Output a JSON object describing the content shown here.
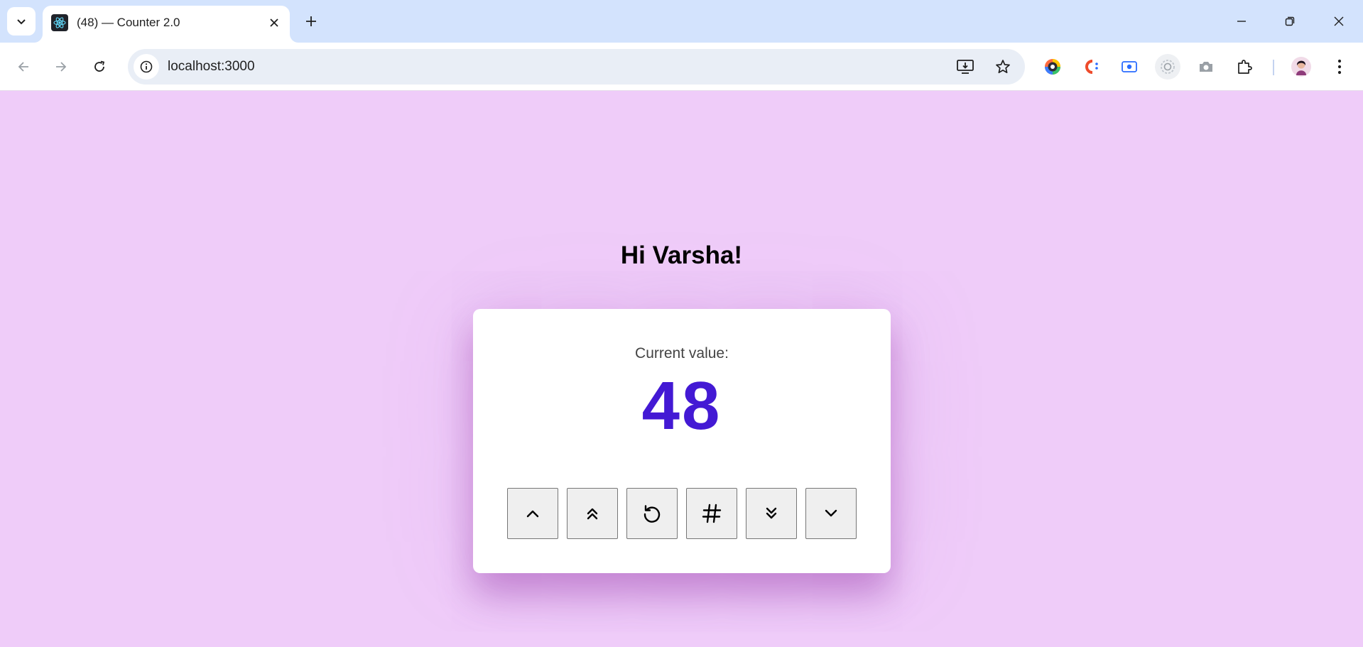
{
  "browser": {
    "tab": {
      "title": "(48) — Counter 2.0",
      "favicon": "react-logo-icon"
    },
    "address_bar": {
      "url": "localhost:3000"
    },
    "extensions": [
      "color-picker-icon",
      "cashback-icon",
      "screen-record-icon",
      "loader-icon",
      "camera-icon",
      "puzzle-icon"
    ],
    "colors": {
      "tabstrip": "#d3e3fd",
      "omnibox": "#e9eef6"
    }
  },
  "page": {
    "greeting": "Hi Varsha!",
    "counter": {
      "label": "Current value:",
      "value": "48"
    },
    "buttons": [
      {
        "name": "increment",
        "icon": "chevron-up-icon"
      },
      {
        "name": "increment-double",
        "icon": "double-chevron-up-icon"
      },
      {
        "name": "reset",
        "icon": "rotate-ccw-icon"
      },
      {
        "name": "set-value",
        "icon": "hash-icon"
      },
      {
        "name": "decrement-double",
        "icon": "double-chevron-down-icon"
      },
      {
        "name": "decrement",
        "icon": "chevron-down-icon"
      }
    ],
    "colors": {
      "background": "#efccf9",
      "value": "#4319d4",
      "card": "#ffffff"
    }
  }
}
